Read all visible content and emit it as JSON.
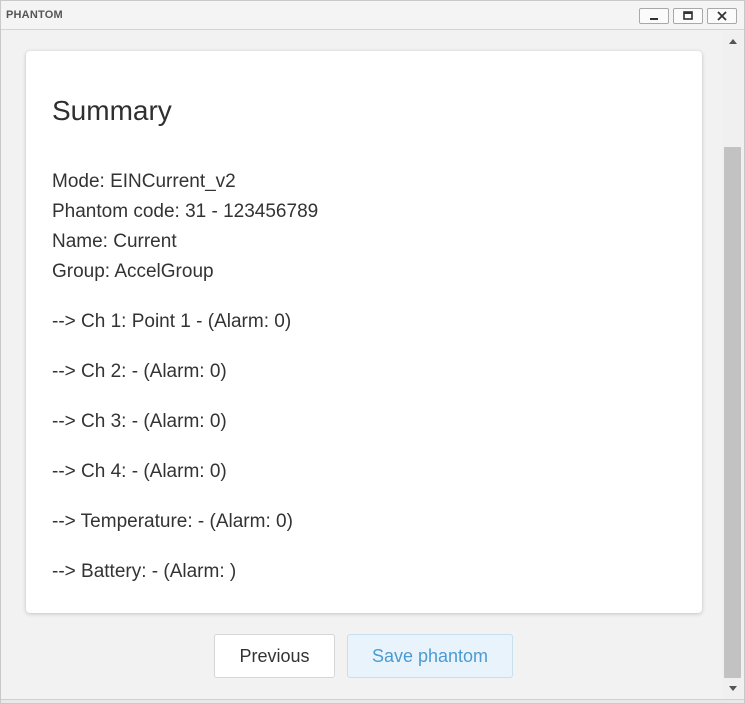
{
  "window": {
    "title": "PHANTOM"
  },
  "summary": {
    "heading": "Summary",
    "lines": [
      "Mode: EINCurrent_v2",
      "Phantom code: 31 - 123456789",
      "Name: Current",
      "Group: AccelGroup",
      "--> Ch 1: Point 1 - (Alarm: 0)",
      "--> Ch 2: - (Alarm: 0)",
      "--> Ch 3: - (Alarm: 0)",
      "--> Ch 4: - (Alarm: 0)",
      "--> Temperature: - (Alarm: 0)",
      "--> Battery: - (Alarm: )"
    ]
  },
  "buttons": {
    "previous": "Previous",
    "save": "Save phantom"
  },
  "icons": {
    "minimize": "minimize-icon",
    "maximize": "maximize-icon",
    "close": "close-icon",
    "scroll_up": "arrow-up-icon",
    "scroll_down": "arrow-down-icon"
  },
  "colors": {
    "accent": "#4a9bd3",
    "save_button_bg": "#e9f3fb"
  }
}
